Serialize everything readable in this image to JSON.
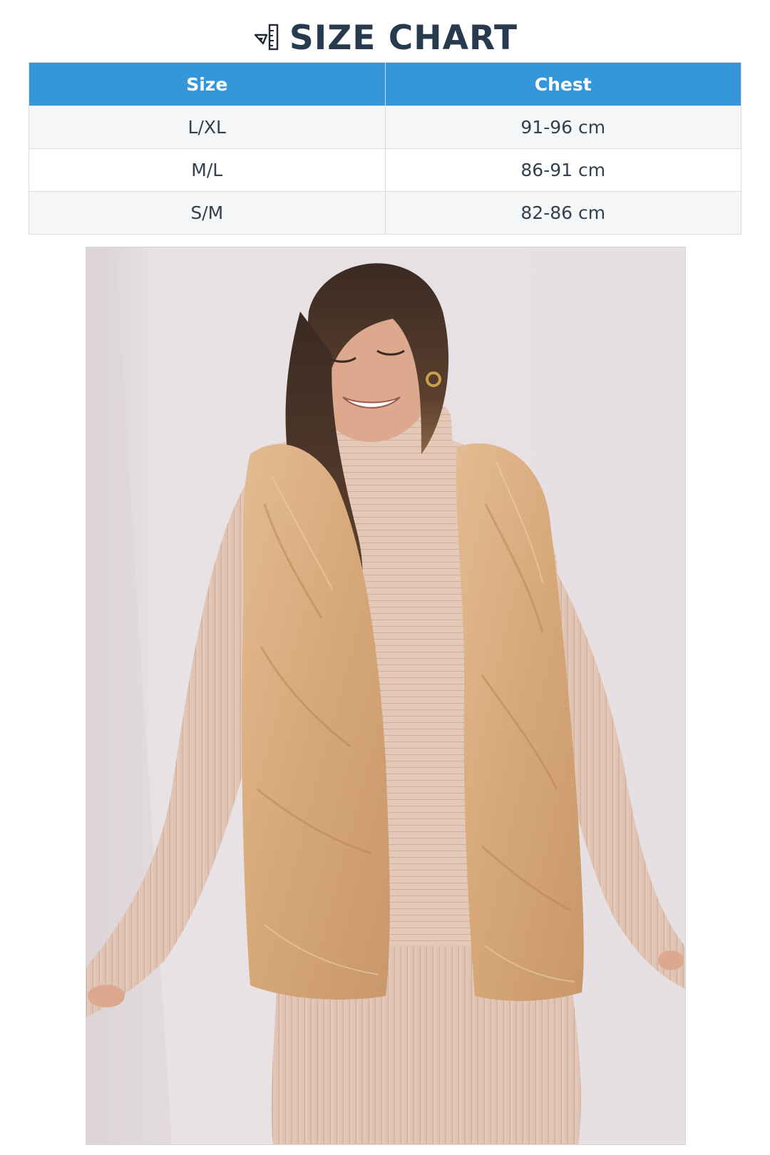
{
  "header": {
    "icon": "ruler-icon",
    "title": "SIZE CHART"
  },
  "size_table": {
    "columns": [
      "Size",
      "Chest"
    ],
    "rows": [
      [
        "L/XL",
        "91-96 cm"
      ],
      [
        "M/L",
        "86-91 cm"
      ],
      [
        "S/M",
        "82-86 cm"
      ]
    ]
  },
  "colors": {
    "header_bg": "#3596da",
    "title_text": "#283a4d",
    "row_alt": "#f4f6f8"
  }
}
